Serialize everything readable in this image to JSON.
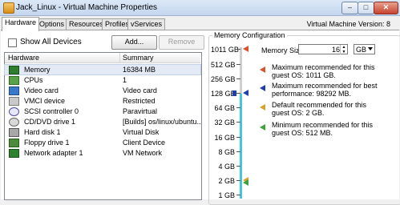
{
  "window": {
    "title": "Jack_Linux - Virtual Machine Properties",
    "controls": {
      "minimize": "–",
      "maximize": "□",
      "close": "✕"
    }
  },
  "tabs": [
    {
      "label": "Hardware",
      "active": true
    },
    {
      "label": "Options",
      "active": false
    },
    {
      "label": "Resources",
      "active": false
    },
    {
      "label": "Profiles",
      "active": false
    },
    {
      "label": "vServices",
      "active": false
    }
  ],
  "vm_version": "Virtual Machine Version: 8",
  "hardware_pane": {
    "show_all_devices_label": "Show All Devices",
    "show_all_devices_checked": false,
    "add_button": "Add...",
    "remove_button": "Remove",
    "columns": [
      "Hardware",
      "Summary"
    ],
    "rows": [
      {
        "icon": "memory-icon",
        "name": "Memory",
        "summary": "16384 MB",
        "selected": true
      },
      {
        "icon": "cpu-icon",
        "name": "CPUs",
        "summary": "1",
        "selected": false
      },
      {
        "icon": "video-card-icon",
        "name": "Video card",
        "summary": "Video card",
        "selected": false
      },
      {
        "icon": "vmci-device-icon",
        "name": "VMCI device",
        "summary": "Restricted",
        "selected": false
      },
      {
        "icon": "scsi-controller-icon",
        "name": "SCSI controller 0",
        "summary": "Paravirtual",
        "selected": false
      },
      {
        "icon": "cd-dvd-icon",
        "name": "CD/DVD drive 1",
        "summary": "[Builds] os/linux/ubuntu...",
        "selected": false
      },
      {
        "icon": "hard-disk-icon",
        "name": "Hard disk 1",
        "summary": "Virtual Disk",
        "selected": false
      },
      {
        "icon": "floppy-icon",
        "name": "Floppy drive 1",
        "summary": "Client Device",
        "selected": false
      },
      {
        "icon": "network-adapter-icon",
        "name": "Network adapter 1",
        "summary": "VM Network",
        "selected": false
      }
    ]
  },
  "memory_config": {
    "group_title": "Memory Configuration",
    "memory_size_label": "Memory Size:",
    "memory_size_value": "16",
    "unit": "GB",
    "scale_ticks": [
      "1011 GB",
      "512 GB",
      "256 GB",
      "128 GB",
      "64 GB",
      "32 GB",
      "16 GB",
      "8 GB",
      "4 GB",
      "2 GB",
      "1 GB"
    ],
    "legend": [
      {
        "color": "#d9532c",
        "line1": "Maximum recommended for this",
        "line2": "guest OS: 1011 GB.",
        "underline_char": "x"
      },
      {
        "color": "#1f3fae",
        "line1": "Maximum recommended for best",
        "line2": "performance: 98292 MB.",
        "underline_char": "r"
      },
      {
        "color": "#d8a22a",
        "line1": "Default recommended for this",
        "line2": "guest OS: 2 GB.",
        "underline_char": "D"
      },
      {
        "color": "#3da33d",
        "line1": "Minimum recommended for this",
        "line2": "guest OS: 512 MB.",
        "underline_char": "M"
      }
    ],
    "colors": {
      "current_fill": "#43c8d6",
      "max_os": "#d9532c",
      "max_perf": "#1f3fae",
      "default": "#d8a22a",
      "minimum": "#3da33d"
    }
  }
}
